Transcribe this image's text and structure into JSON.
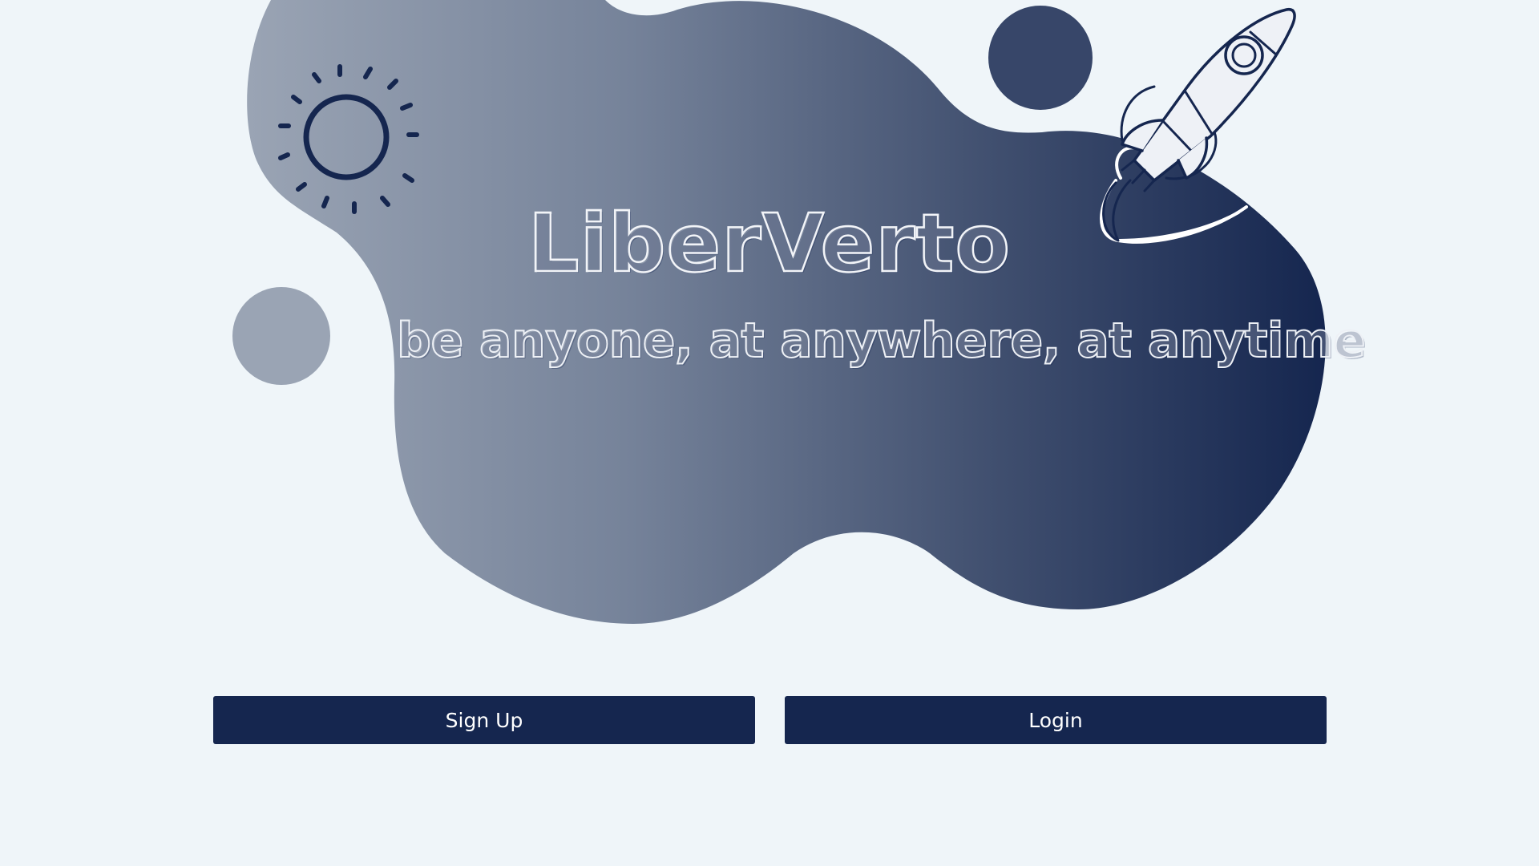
{
  "brand": {
    "title": "LiberVerto",
    "tagline": "be anyone, at anywhere, at anytime"
  },
  "actions": {
    "signup_label": "Sign Up",
    "login_label": "Login"
  },
  "icons": {
    "sun": "sun-icon",
    "rocket": "rocket-icon"
  },
  "colors": {
    "background": "#eff5f9",
    "primary": "#15264f",
    "blob_light": "#9aa4b4",
    "blob_dark": "#15264f"
  }
}
